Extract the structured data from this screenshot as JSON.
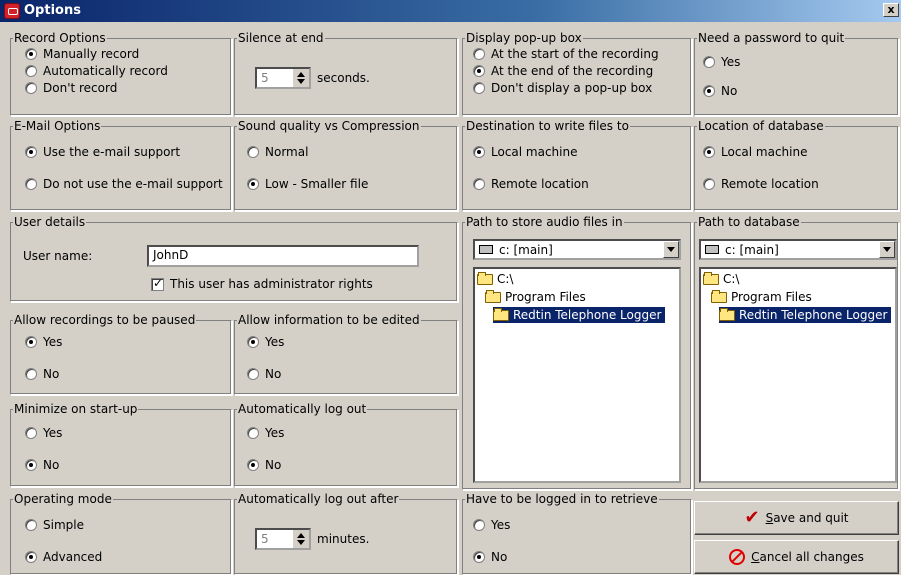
{
  "window": {
    "title": "Options",
    "close_glyph": "x"
  },
  "record_options": {
    "legend": "Record Options",
    "options": [
      "Manually record",
      "Automatically record",
      "Don't record"
    ],
    "selected": 0
  },
  "silence_at_end": {
    "legend": "Silence at end",
    "value": "5",
    "unit": "seconds."
  },
  "popup_box": {
    "legend": "Display pop-up box",
    "options": [
      "At the start of the recording",
      "At the end of the recording",
      "Don't display a pop-up box"
    ],
    "selected": 1
  },
  "password_quit": {
    "legend": "Need a password to quit",
    "options": [
      "Yes",
      "No"
    ],
    "selected": 1
  },
  "email_options": {
    "legend": "E-Mail Options",
    "options": [
      "Use the e-mail support",
      "Do not use the e-mail support"
    ],
    "selected": 0
  },
  "sound_quality": {
    "legend": "Sound quality vs Compression",
    "options": [
      "Normal",
      "Low - Smaller file"
    ],
    "selected": 1
  },
  "destination": {
    "legend": "Destination to write files to",
    "options": [
      "Local machine",
      "Remote location"
    ],
    "selected": 0
  },
  "db_location": {
    "legend": "Location of database",
    "options": [
      "Local machine",
      "Remote location"
    ],
    "selected": 0
  },
  "user_details": {
    "legend": "User details",
    "username_label": "User name:",
    "username_value": "JohnD",
    "admin_label": "This user has administrator rights",
    "admin_checked": true
  },
  "audio_path": {
    "legend": "Path to store audio files in",
    "drive": "c: [main]",
    "folders": [
      "C:\\",
      "Program Files",
      "Redtin Telephone Logger"
    ],
    "selected": 2
  },
  "db_path": {
    "legend": "Path to database",
    "drive": "c: [main]",
    "folders": [
      "C:\\",
      "Program Files",
      "Redtin Telephone Logger"
    ],
    "selected": 2
  },
  "pause": {
    "legend": "Allow recordings to be paused",
    "options": [
      "Yes",
      "No"
    ],
    "selected": 0
  },
  "edit_info": {
    "legend": "Allow information to be edited",
    "options": [
      "Yes",
      "No"
    ],
    "selected": 0
  },
  "minimize": {
    "legend": "Minimize on start-up",
    "options": [
      "Yes",
      "No"
    ],
    "selected": 1
  },
  "auto_logout": {
    "legend": "Automatically log out",
    "options": [
      "Yes",
      "No"
    ],
    "selected": 1
  },
  "operating_mode": {
    "legend": "Operating mode",
    "options": [
      "Simple",
      "Advanced"
    ],
    "selected": 1
  },
  "logout_after": {
    "legend": "Automatically log out after",
    "value": "5",
    "unit": "minutes."
  },
  "login_retrieve": {
    "legend": "Have to be logged in to retrieve",
    "options": [
      "Yes",
      "No"
    ],
    "selected": 1
  },
  "buttons": {
    "save_mnemonic": "S",
    "save_rest": "ave and quit",
    "cancel_mnemonic": "C",
    "cancel_rest": "ancel all changes"
  },
  "colors": {
    "titlebar_start": "#0a246a",
    "face": "#d4d0c8",
    "selection": "#0a246a",
    "save_icon": "#c00000",
    "cancel_icon": "#e00000"
  },
  "icons": {
    "save": "checkmark-icon",
    "cancel": "no-entry-icon",
    "folder": "folder-icon",
    "drive": "drive-icon"
  }
}
